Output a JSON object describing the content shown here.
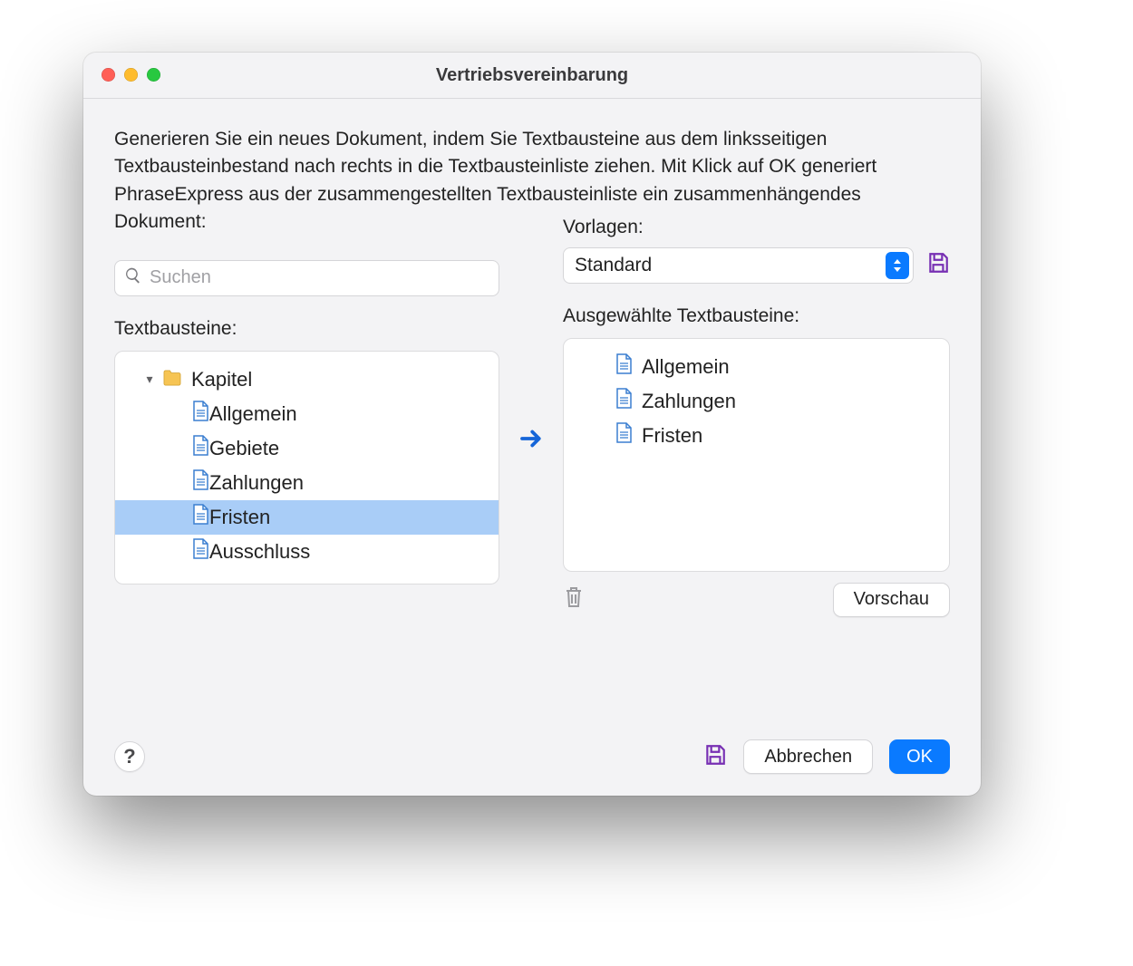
{
  "window": {
    "title": "Vertriebsvereinbarung"
  },
  "description": "Generieren Sie ein neues Dokument, indem Sie Textbausteine aus dem linksseitigen Textbausteinbestand nach rechts in die Textbausteinliste ziehen. Mit Klick auf OK generiert PhraseExpress aus der zusammengestellten Textbausteinliste ein zusammenhängendes Dokument:",
  "search": {
    "placeholder": "Suchen",
    "value": ""
  },
  "left": {
    "label": "Textbausteine:",
    "folder": "Kapitel",
    "items": [
      {
        "label": "Allgemein",
        "selected": false
      },
      {
        "label": "Gebiete",
        "selected": false
      },
      {
        "label": "Zahlungen",
        "selected": false
      },
      {
        "label": "Fristen",
        "selected": true
      },
      {
        "label": "Ausschluss",
        "selected": false
      }
    ]
  },
  "right": {
    "templates_label": "Vorlagen:",
    "template": "Standard",
    "selected_label": "Ausgewählte Textbausteine:",
    "items": [
      {
        "label": "Allgemein"
      },
      {
        "label": "Zahlungen"
      },
      {
        "label": "Fristen"
      }
    ],
    "preview": "Vorschau"
  },
  "footer": {
    "help": "?",
    "cancel": "Abbrechen",
    "ok": "OK"
  }
}
